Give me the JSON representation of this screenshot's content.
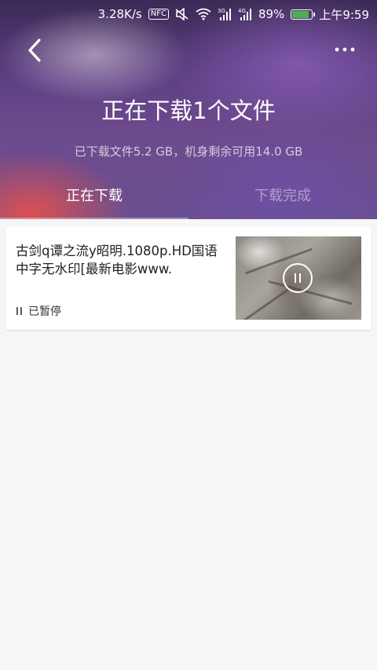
{
  "status_bar": {
    "speed": "3.28K/s",
    "nfc": "NFC",
    "network_3g": "3G",
    "network_4g": "4G",
    "battery": "89%",
    "battery_level": 0.89,
    "time": "上午9:59"
  },
  "header": {
    "back_icon": "chevron-left-icon",
    "more_icon": "more-dots-icon",
    "title": "正在下载1个文件",
    "subtitle": "已下载文件5.2 GB，机身剩余可用14.0 GB"
  },
  "tabs": [
    {
      "label": "正在下载",
      "active": true
    },
    {
      "label": "下载完成",
      "active": false
    }
  ],
  "downloads": [
    {
      "name": "古剑q谭之流y昭明.1080p.HD国语中字无水印[最新电影www.",
      "status": "已暂停",
      "status_icon": "pause-icon"
    }
  ]
}
